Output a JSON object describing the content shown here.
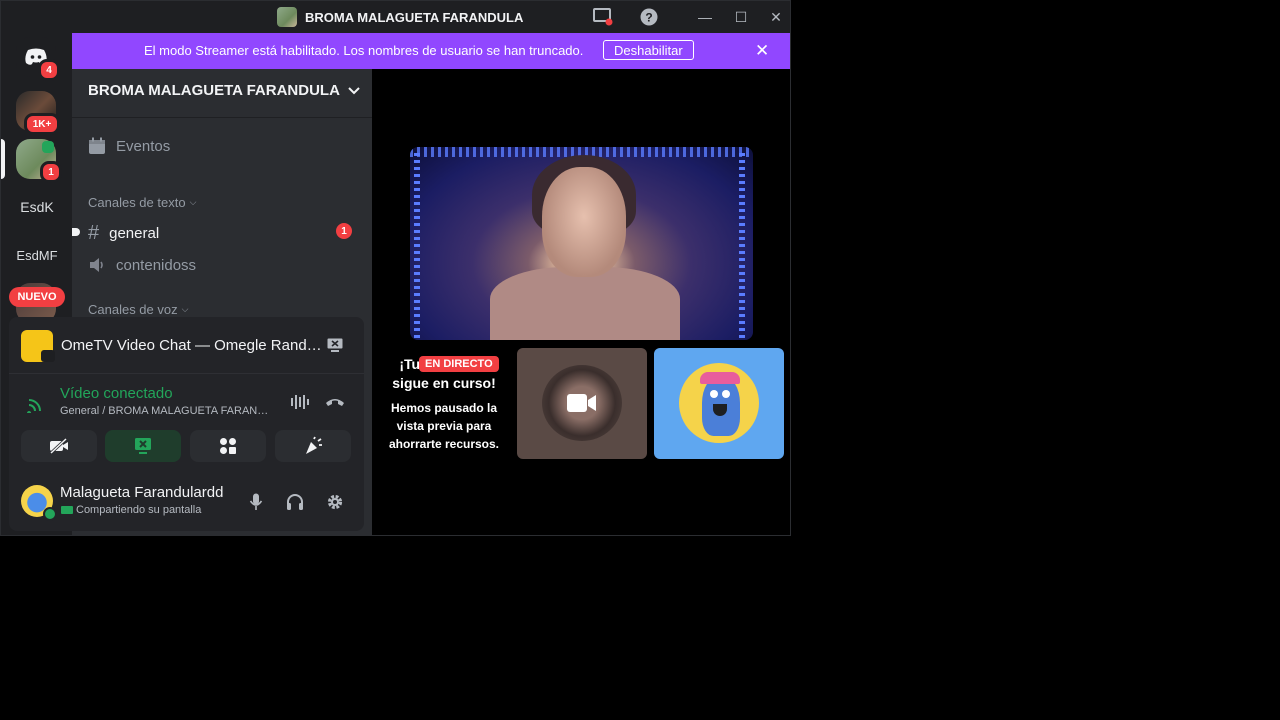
{
  "window": {
    "title": "BROMA MALAGUETA FARANDULA"
  },
  "banner": {
    "message": "El modo Streamer está habilitado. Los nombres de usuario se han truncado.",
    "button": "Deshabilitar"
  },
  "rail": {
    "home_badge": "4",
    "server1_badge": "1K+",
    "server2_badge": "1",
    "server3_label": "EsdK",
    "server4_label": "EsdMF",
    "new_badge": "NUEVO"
  },
  "sidebar": {
    "guild_name": "BROMA MALAGUETA FARANDULA",
    "events": "Eventos",
    "text_category": "Canales de texto",
    "channels": [
      {
        "name": "general",
        "badge": "1"
      },
      {
        "name": "contenidoss"
      }
    ],
    "voice_category": "Canales de voz"
  },
  "activity": {
    "title": "OmeTV Video Chat — Omegle Rand…"
  },
  "voice": {
    "status": "Vídeo conectado",
    "location": "General / BROMA MALAGUETA FARAN…"
  },
  "user": {
    "name": "Malagueta Farandulardd",
    "status": "Compartiendo su pantalla"
  },
  "stage": {
    "live_tag": "EN DIRECTO",
    "live_heading_a": "¡Tu t",
    "live_heading_b": "sigue en curso!",
    "paused_text": "Hemos pausado la vista previa para ahorrarte recursos."
  },
  "colors": {
    "accent_purple": "#9147ff",
    "danger_red": "#f23f42",
    "connected_green": "#23a55a"
  }
}
